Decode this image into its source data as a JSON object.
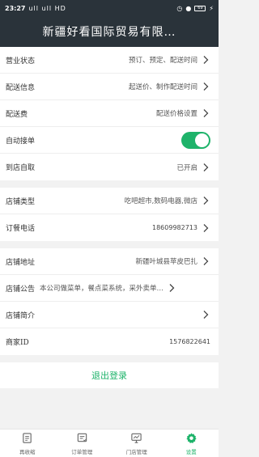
{
  "status_bar": {
    "time": "23:27",
    "signal": "ull ull HD",
    "battery": "69"
  },
  "header": {
    "title": "新疆好看国际贸易有限…"
  },
  "groups": [
    [
      {
        "label": "营业状态",
        "value": "预订、预定、配送时间"
      },
      {
        "label": "配送信息",
        "value": "起送价、制作配送时间"
      },
      {
        "label": "配送费",
        "value": "配送价格设置"
      },
      {
        "label": "自动接单",
        "toggle": true
      },
      {
        "label": "到店自取",
        "value": "已开启"
      }
    ],
    [
      {
        "label": "店铺类型",
        "value": "吃吧超市,数码电器,微店"
      },
      {
        "label": "订餐电话",
        "value": "18609982713"
      }
    ],
    [
      {
        "label": "店铺地址",
        "value": "新疆叶城县苹皮巴扎"
      },
      {
        "label": "店铺公告",
        "value": "本公司做菜单，餐点菜系统，采外卖单…"
      },
      {
        "label": "店铺简介",
        "value": ""
      },
      {
        "label": "商家ID",
        "value": "1576822641"
      }
    ]
  ],
  "logout_label": "退出登录",
  "tabs": [
    {
      "label": "再收缩",
      "icon": "document-icon"
    },
    {
      "label": "订单管理",
      "icon": "order-list-icon"
    },
    {
      "label": "门店管理",
      "icon": "store-monitor-icon"
    },
    {
      "label": "设置",
      "icon": "gear-icon",
      "active": true
    }
  ],
  "colors": {
    "accent": "#1eb36a",
    "header_bg": "#2a333a"
  }
}
